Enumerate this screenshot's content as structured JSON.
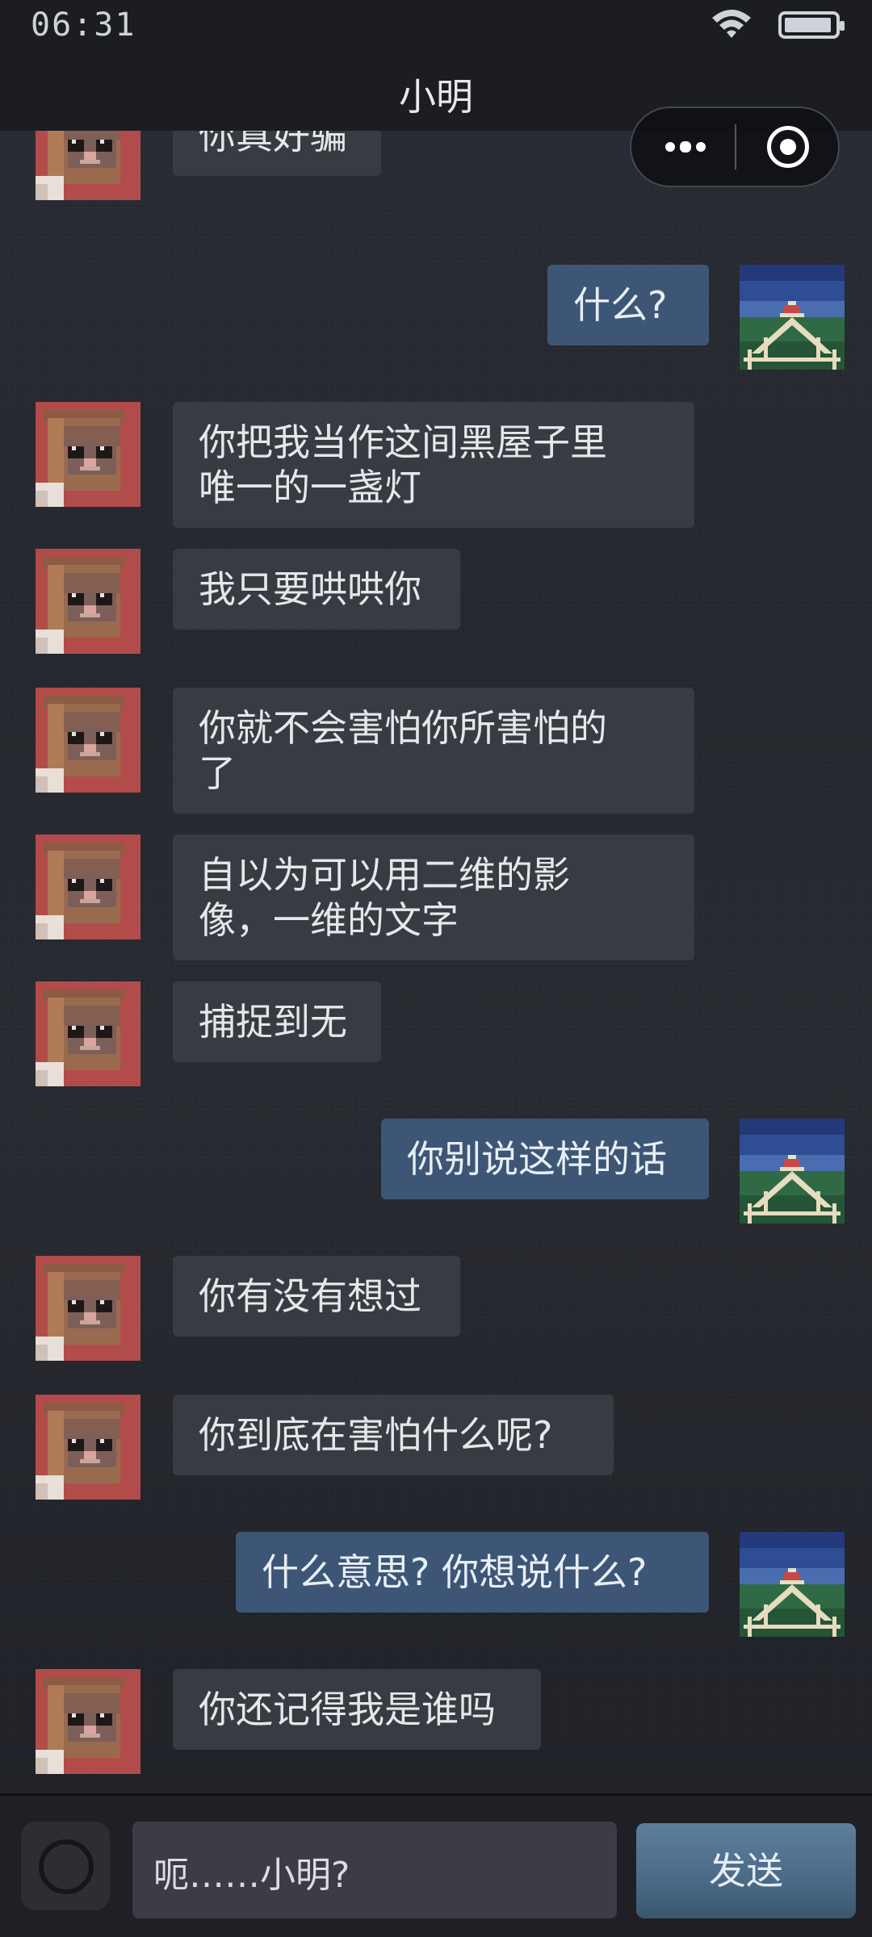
{
  "status_bar": {
    "time": "06:31",
    "battery_level": 0.95
  },
  "header": {
    "title": "小明"
  },
  "messages": [
    {
      "side": "left",
      "text": "你真好骗"
    },
    {
      "side": "right",
      "text": "什么?"
    },
    {
      "side": "left",
      "text": "你把我当作这间黑屋子里\n唯一的一盏灯"
    },
    {
      "side": "left",
      "text": "我只要哄哄你"
    },
    {
      "side": "left",
      "text": "你就不会害怕你所害怕的\n了"
    },
    {
      "side": "left",
      "text": "自以为可以用二维的影\n像，一维的文字"
    },
    {
      "side": "left",
      "text": "捕捉到无"
    },
    {
      "side": "right",
      "text": "你别说这样的话"
    },
    {
      "side": "left",
      "text": "你有没有想过"
    },
    {
      "side": "left",
      "text": "你到底在害怕什么呢?"
    },
    {
      "side": "right",
      "text": "什么意思? 你想说什么?"
    },
    {
      "side": "left",
      "text": "你还记得我是谁吗"
    }
  ],
  "composer": {
    "input_value": "呃……小明?",
    "send_label": "发送"
  }
}
